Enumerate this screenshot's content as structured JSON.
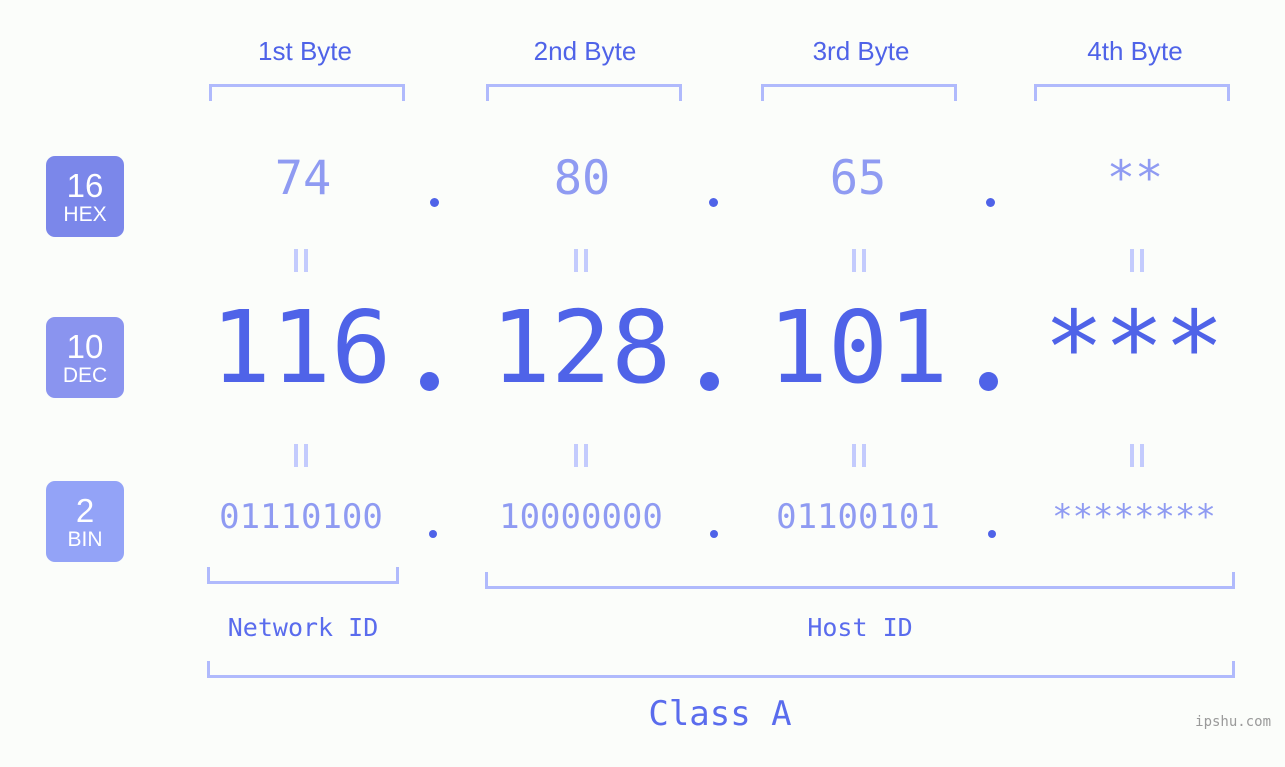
{
  "header": {
    "byte_labels": [
      "1st Byte",
      "2nd Byte",
      "3rd Byte",
      "4th Byte"
    ]
  },
  "bases": [
    {
      "number": "16",
      "name": "HEX",
      "color": "#7b87ea"
    },
    {
      "number": "10",
      "name": "DEC",
      "color": "#8a94ef"
    },
    {
      "number": "2",
      "name": "BIN",
      "color": "#93a3f7"
    }
  ],
  "rows": {
    "hex": {
      "base_number": "16",
      "base_name": "HEX",
      "values": [
        "74",
        "80",
        "65",
        "**"
      ],
      "separator": "."
    },
    "dec": {
      "base_number": "10",
      "base_name": "DEC",
      "values": [
        "116",
        "128",
        "101",
        "***"
      ],
      "separator": "."
    },
    "bin": {
      "base_number": "2",
      "base_name": "BIN",
      "values": [
        "01110100",
        "10000000",
        "01100101",
        "********"
      ],
      "separator": "."
    }
  },
  "equals_marks": {
    "glyph": "=",
    "count_per_row": 4
  },
  "footer": {
    "network_id_label": "Network ID",
    "host_id_label": "Host ID",
    "class_label": "Class A"
  },
  "watermark": "ipshu.com",
  "colors": {
    "background": "#fbfdfa",
    "accent_strong": "#4f63e8",
    "accent_mid": "#8f9bf2",
    "accent_light": "#b0bafc",
    "equals": "#c3cbfd",
    "watermark": "#9a9a9a"
  }
}
